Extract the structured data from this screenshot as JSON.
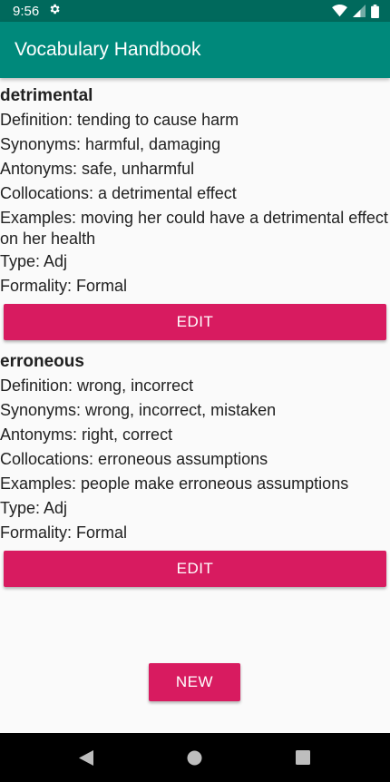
{
  "status_bar": {
    "time": "9:56"
  },
  "app_bar": {
    "title": "Vocabulary Handbook"
  },
  "entries": [
    {
      "word": "detrimental",
      "definition": "Definition: tending to cause harm",
      "synonyms": "Synonyms: harmful, damaging",
      "antonyms": "Antonyms: safe, unharmful",
      "collocations": "Collocations: a detrimental effect",
      "examples": "Examples: moving her could have a detrimental effect on her health",
      "type": "Type: Adj",
      "formality": "Formality: Formal",
      "edit_label": "EDIT"
    },
    {
      "word": "erroneous",
      "definition": "Definition: wrong, incorrect",
      "synonyms": "Synonyms: wrong, incorrect, mistaken",
      "antonyms": "Antonyms: right, correct",
      "collocations": "Collocations: erroneous assumptions",
      "examples": "Examples: people make erroneous assumptions",
      "type": "Type: Adj",
      "formality": "Formality: Formal",
      "edit_label": "EDIT"
    }
  ],
  "new_button": {
    "label": "NEW"
  },
  "icons": {
    "status": [
      "gear-icon",
      "wifi-icon",
      "cell-signal-icon",
      "battery-icon"
    ],
    "navigation": [
      "back-icon",
      "home-icon",
      "recents-icon"
    ]
  },
  "colors": {
    "status_bar": "#00695c",
    "app_bar": "#00897b",
    "accent": "#d81b60",
    "background": "#fafafa",
    "nav_bar": "#000000"
  }
}
